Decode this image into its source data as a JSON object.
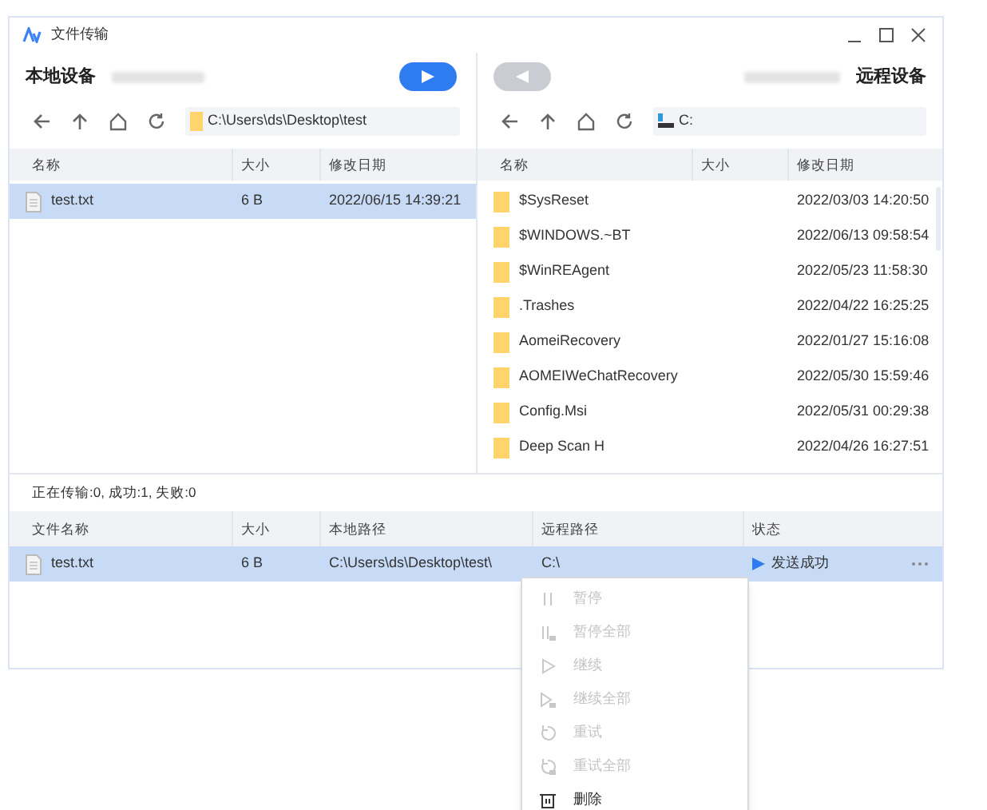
{
  "window": {
    "title": "文件传输"
  },
  "local": {
    "title": "本地设备",
    "send_button": {
      "disabled": false
    },
    "path": "C:\\Users\\ds\\Desktop\\test",
    "columns": [
      "名称",
      "大小",
      "修改日期"
    ],
    "rows": [
      {
        "kind": "file",
        "name": "test.txt",
        "size": "6 B",
        "modified": "2022/06/15 14:39:21",
        "selected": true
      }
    ]
  },
  "remote": {
    "title": "远程设备",
    "send_button": {
      "disabled": true
    },
    "path": "C:",
    "columns": [
      "名称",
      "大小",
      "修改日期"
    ],
    "rows": [
      {
        "kind": "folder",
        "name": "$SysReset",
        "modified": "2022/03/03 14:20:50",
        "selected": false
      },
      {
        "kind": "folder",
        "name": "$WINDOWS.~BT",
        "modified": "2022/06/13 09:58:54",
        "selected": false
      },
      {
        "kind": "folder",
        "name": "$WinREAgent",
        "modified": "2022/05/23 11:58:30",
        "selected": false
      },
      {
        "kind": "folder",
        "name": ".Trashes",
        "modified": "2022/04/22 16:25:25",
        "selected": false
      },
      {
        "kind": "folder",
        "name": "AomeiRecovery",
        "modified": "2022/01/27 15:16:08",
        "selected": false
      },
      {
        "kind": "folder",
        "name": "AOMEIWeChatRecovery",
        "modified": "2022/05/30 15:59:46",
        "selected": false
      },
      {
        "kind": "folder",
        "name": "Config.Msi",
        "modified": "2022/05/31 00:29:38",
        "selected": false
      },
      {
        "kind": "folder",
        "name": "Deep Scan H",
        "modified": "2022/04/26 16:27:51",
        "selected": false
      }
    ]
  },
  "transfer": {
    "summary": "正在传输:0, 成功:1, 失败:0",
    "columns": [
      "文件名称",
      "大小",
      "本地路径",
      "远程路径",
      "状态"
    ],
    "rows": [
      {
        "name": "test.txt",
        "size": "6 B",
        "local_path": "C:\\Users\\ds\\Desktop\\test\\",
        "remote_path": "C:\\",
        "status": "发送成功",
        "selected": true
      }
    ]
  },
  "context_menu": [
    {
      "kind": "pause",
      "label": "暂停",
      "disabled": true
    },
    {
      "kind": "pause-all",
      "label": "暂停全部",
      "disabled": true
    },
    {
      "kind": "resume",
      "label": "继续",
      "disabled": true
    },
    {
      "kind": "resume-all",
      "label": "继续全部",
      "disabled": true
    },
    {
      "kind": "retry",
      "label": "重试",
      "disabled": true
    },
    {
      "kind": "retry-all",
      "label": "重试全部",
      "disabled": true
    },
    {
      "kind": "delete",
      "label": "删除",
      "disabled": false
    }
  ]
}
